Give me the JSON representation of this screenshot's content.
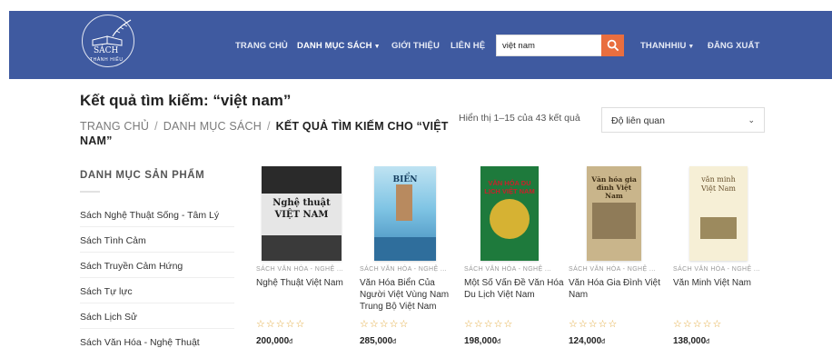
{
  "header": {
    "logo": {
      "brand_line1": "SÁCH",
      "brand_line2": "THÀNH HIẾU"
    },
    "nav": [
      {
        "label": "TRANG CHỦ"
      },
      {
        "label": "DANH MỤC SÁCH"
      },
      {
        "label": "GIỚI THIỆU"
      },
      {
        "label": "LIÊN HỆ"
      }
    ],
    "search": {
      "value": "việt nam"
    },
    "user_menu": {
      "label": "THANHHIU"
    },
    "logout_label": "ĐĂNG XUẤT"
  },
  "page": {
    "title": "Kết quả tìm kiếm: “việt nam”",
    "breadcrumb": {
      "home": "TRANG CHỦ",
      "category": "DANH MỤC SÁCH",
      "current": "KẾT QUẢ TÌM KIẾM CHO “VIỆT NAM”"
    },
    "result_count": "Hiển thị 1–15 của 43 kết quả",
    "sort": {
      "selected": "Độ liên quan"
    }
  },
  "sidebar": {
    "title": "DANH MỤC SẢN PHẨM",
    "items": [
      "Sách Nghệ Thuật Sống - Tâm Lý",
      "Sách Tình Cảm",
      "Sách Truyền Cảm Hứng",
      "Sách Tự lực",
      "Sách Lịch Sử",
      "Sách Văn Hóa - Nghệ Thuật"
    ]
  },
  "products": [
    {
      "category": "SÁCH VĂN HÓA - NGHỆ ...",
      "name": "Nghệ Thuật Việt Nam",
      "price": "200,000",
      "currency": "đ",
      "cover_title": "Nghệ thuật VIỆT NAM",
      "rating": 0
    },
    {
      "category": "SÁCH VĂN HÓA - NGHỆ ...",
      "name": "Văn Hóa Biển Của Người Việt Vùng Nam Trung Bộ Việt Nam",
      "price": "285,000",
      "currency": "đ",
      "cover_title": "BIỂN",
      "rating": 0
    },
    {
      "category": "SÁCH VĂN HÓA - NGHỆ ...",
      "name": "Một Số Vấn Đề Văn Hóa Du Lịch Việt Nam",
      "price": "198,000",
      "currency": "đ",
      "cover_title": "VĂN HÓA DU LỊCH VIỆT NAM",
      "rating": 0
    },
    {
      "category": "SÁCH VĂN HÓA - NGHỆ ...",
      "name": "Văn Hóa Gia Đình Việt Nam",
      "price": "124,000",
      "currency": "đ",
      "cover_title": "Văn hóa gia đình Việt Nam",
      "rating": 0
    },
    {
      "category": "SÁCH VĂN HÓA - NGHỆ ...",
      "name": "Văn Minh Việt Nam",
      "price": "138,000",
      "currency": "đ",
      "cover_title": "văn minh Việt Nam",
      "rating": 0
    }
  ],
  "colors": {
    "header_bg": "#3f5aa0",
    "search_button": "#e96e3f",
    "star": "#e2a83a"
  },
  "icons": {
    "search": "magnifier-icon",
    "dropdown": "chevron-down-icon",
    "rating": "star-outline-icon"
  }
}
